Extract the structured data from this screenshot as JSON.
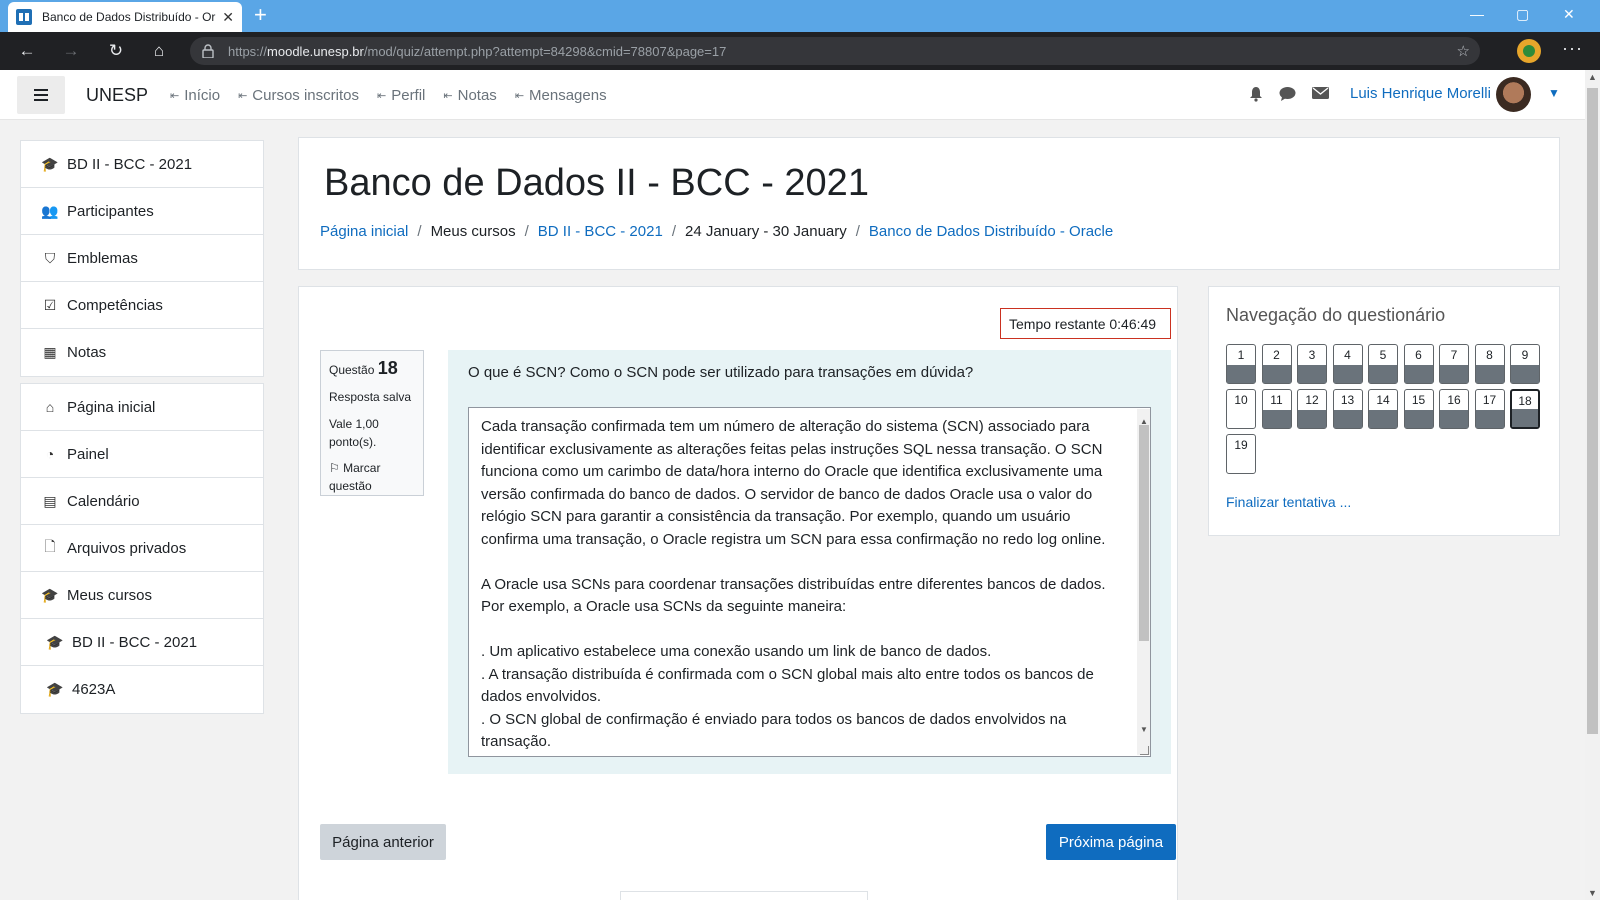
{
  "browser": {
    "tab_title": "Banco de Dados Distribuído - Or",
    "url_scheme": "https://",
    "url_host": "moodle.unesp.br",
    "url_path": "/mod/quiz/attempt.php?attempt=84298&cmid=78807&page=17",
    "window_controls": [
      "—",
      "▢",
      "✕"
    ]
  },
  "navbar": {
    "brand": "UNESP",
    "links": [
      "Início",
      "Cursos inscritos",
      "Perfil",
      "Notas",
      "Mensagens"
    ],
    "user_name": "Luis Henrique Morelli"
  },
  "drawer": {
    "group1": [
      {
        "label": "BD II - BCC - 2021",
        "icon": "graduation-cap-icon"
      },
      {
        "label": "Participantes",
        "icon": "users-icon"
      },
      {
        "label": "Emblemas",
        "icon": "shield-icon"
      },
      {
        "label": "Competências",
        "icon": "checkbox-icon"
      },
      {
        "label": "Notas",
        "icon": "table-icon"
      }
    ],
    "group2": [
      {
        "label": "Página inicial",
        "icon": "home-icon"
      },
      {
        "label": "Painel",
        "icon": "dashboard-icon"
      },
      {
        "label": "Calendário",
        "icon": "calendar-icon"
      },
      {
        "label": "Arquivos privados",
        "icon": "file-icon"
      },
      {
        "label": "Meus cursos",
        "icon": "graduation-cap-icon"
      },
      {
        "label": "BD II - BCC - 2021",
        "icon": "graduation-cap-icon"
      },
      {
        "label": "4623A",
        "icon": "graduation-cap-icon"
      }
    ]
  },
  "header": {
    "title": "Banco de Dados II - BCC - 2021",
    "breadcrumb": [
      "Página inicial",
      "Meus cursos",
      "BD II - BCC - 2021",
      "24 January - 30 January",
      "Banco de Dados Distribuído - Oracle"
    ]
  },
  "quiz": {
    "timer": "Tempo restante 0:46:49",
    "question_label": "Questão",
    "question_number": "18",
    "status": "Resposta salva",
    "mark_line1": "Vale 1,00",
    "mark_line2": "ponto(s).",
    "flag_label": "Marcar questão",
    "question_text": "O que é SCN? Como o SCN pode ser utilizado para transações em dúvida?",
    "answer_paragraphs": [
      "Cada transação confirmada tem um número de alteração do sistema (SCN) associado para identificar exclusivamente as alterações feitas pelas instruções SQL nessa transação. O SCN funciona como um carimbo de data/hora interno do Oracle que identifica exclusivamente uma versão confirmada do banco de dados. O servidor de banco de dados Oracle usa o valor do relógio SCN para garantir a consistência da transação. Por exemplo, quando um usuário confirma uma transação, o Oracle registra um SCN para essa confirmação no redo log online.",
      "",
      "A Oracle usa SCNs para coordenar transações distribuídas entre diferentes bancos de dados. Por exemplo, a Oracle usa SCNs da seguinte maneira:",
      "",
      ". Um aplicativo estabelece uma conexão usando um link de banco de dados.",
      ". A transação distribuída é confirmada com o SCN global mais alto entre todos os bancos de dados envolvidos.",
      ". O SCN global de confirmação é enviado para todos os bancos de dados envolvidos na transação."
    ],
    "prev_button": "Página anterior",
    "next_button": "Próxima página"
  },
  "quiz_nav": {
    "title": "Navegação do questionário",
    "buttons": [
      {
        "n": "1",
        "answered": true
      },
      {
        "n": "2",
        "answered": true
      },
      {
        "n": "3",
        "answered": true
      },
      {
        "n": "4",
        "answered": true
      },
      {
        "n": "5",
        "answered": true
      },
      {
        "n": "6",
        "answered": true
      },
      {
        "n": "7",
        "answered": true
      },
      {
        "n": "8",
        "answered": true
      },
      {
        "n": "9",
        "answered": true
      },
      {
        "n": "10",
        "answered": false
      },
      {
        "n": "11",
        "answered": true
      },
      {
        "n": "12",
        "answered": true
      },
      {
        "n": "13",
        "answered": true
      },
      {
        "n": "14",
        "answered": true
      },
      {
        "n": "15",
        "answered": true
      },
      {
        "n": "16",
        "answered": true
      },
      {
        "n": "17",
        "answered": true
      },
      {
        "n": "18",
        "answered": true,
        "current": true
      },
      {
        "n": "19",
        "answered": false
      }
    ],
    "finish_link": "Finalizar tentativa ..."
  },
  "colors": {
    "link": "#0f6cbf",
    "primary_button": "#0f6cbf",
    "timer_border": "#ca3120",
    "question_bg": "#e7f3f5",
    "tab_strip": "#5aa6e6"
  }
}
